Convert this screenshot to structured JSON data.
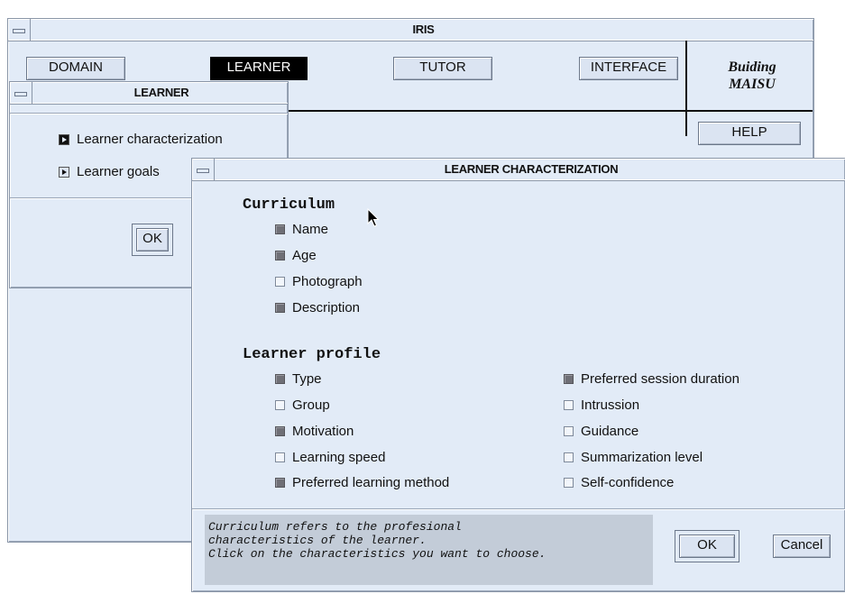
{
  "iris": {
    "title": "IRIS",
    "tabs": [
      "DOMAIN",
      "LEARNER",
      "TUTOR",
      "INTERFACE"
    ],
    "logo_line1": "Buiding",
    "logo_line2": "MAISU",
    "help_label": "HELP"
  },
  "learner_window": {
    "title": "LEARNER",
    "options": [
      "Learner characterization",
      "Learner goals"
    ],
    "ok_label": "OK"
  },
  "characterization_window": {
    "title": "LEARNER CHARACTERIZATION",
    "curriculum_heading": "Curriculum",
    "curriculum_items": [
      {
        "label": "Name",
        "checked": true
      },
      {
        "label": "Age",
        "checked": true
      },
      {
        "label": "Photograph",
        "checked": false
      },
      {
        "label": "Description",
        "checked": true
      }
    ],
    "profile_heading": "Learner profile",
    "profile_left": [
      {
        "label": "Type",
        "checked": true
      },
      {
        "label": "Group",
        "checked": false
      },
      {
        "label": "Motivation",
        "checked": true
      },
      {
        "label": "Learning speed",
        "checked": false
      },
      {
        "label": "Preferred learning method",
        "checked": true
      }
    ],
    "profile_right": [
      {
        "label": "Preferred session duration",
        "checked": true
      },
      {
        "label": "Intrussion",
        "checked": false
      },
      {
        "label": "Guidance",
        "checked": false
      },
      {
        "label": "Summarization level",
        "checked": false
      },
      {
        "label": "Self-confidence",
        "checked": false
      }
    ],
    "message": "Curriculum refers to the profesional\ncharacteristics of the learner.\nClick on the characteristics you want to choose.",
    "ok_label": "OK",
    "cancel_label": "Cancel"
  }
}
